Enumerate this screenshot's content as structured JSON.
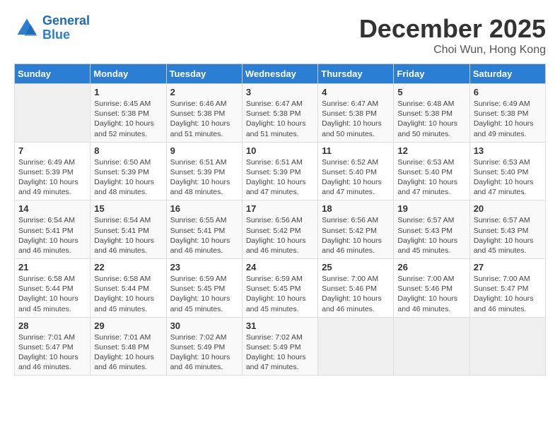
{
  "header": {
    "logo_line1": "General",
    "logo_line2": "Blue",
    "month": "December 2025",
    "location": "Choi Wun, Hong Kong"
  },
  "days_of_week": [
    "Sunday",
    "Monday",
    "Tuesday",
    "Wednesday",
    "Thursday",
    "Friday",
    "Saturday"
  ],
  "weeks": [
    [
      {
        "day": "",
        "empty": true
      },
      {
        "day": "1",
        "sunrise": "Sunrise: 6:45 AM",
        "sunset": "Sunset: 5:38 PM",
        "daylight": "Daylight: 10 hours and 52 minutes."
      },
      {
        "day": "2",
        "sunrise": "Sunrise: 6:46 AM",
        "sunset": "Sunset: 5:38 PM",
        "daylight": "Daylight: 10 hours and 51 minutes."
      },
      {
        "day": "3",
        "sunrise": "Sunrise: 6:47 AM",
        "sunset": "Sunset: 5:38 PM",
        "daylight": "Daylight: 10 hours and 51 minutes."
      },
      {
        "day": "4",
        "sunrise": "Sunrise: 6:47 AM",
        "sunset": "Sunset: 5:38 PM",
        "daylight": "Daylight: 10 hours and 50 minutes."
      },
      {
        "day": "5",
        "sunrise": "Sunrise: 6:48 AM",
        "sunset": "Sunset: 5:38 PM",
        "daylight": "Daylight: 10 hours and 50 minutes."
      },
      {
        "day": "6",
        "sunrise": "Sunrise: 6:49 AM",
        "sunset": "Sunset: 5:38 PM",
        "daylight": "Daylight: 10 hours and 49 minutes."
      }
    ],
    [
      {
        "day": "7",
        "sunrise": "Sunrise: 6:49 AM",
        "sunset": "Sunset: 5:39 PM",
        "daylight": "Daylight: 10 hours and 49 minutes."
      },
      {
        "day": "8",
        "sunrise": "Sunrise: 6:50 AM",
        "sunset": "Sunset: 5:39 PM",
        "daylight": "Daylight: 10 hours and 48 minutes."
      },
      {
        "day": "9",
        "sunrise": "Sunrise: 6:51 AM",
        "sunset": "Sunset: 5:39 PM",
        "daylight": "Daylight: 10 hours and 48 minutes."
      },
      {
        "day": "10",
        "sunrise": "Sunrise: 6:51 AM",
        "sunset": "Sunset: 5:39 PM",
        "daylight": "Daylight: 10 hours and 47 minutes."
      },
      {
        "day": "11",
        "sunrise": "Sunrise: 6:52 AM",
        "sunset": "Sunset: 5:40 PM",
        "daylight": "Daylight: 10 hours and 47 minutes."
      },
      {
        "day": "12",
        "sunrise": "Sunrise: 6:53 AM",
        "sunset": "Sunset: 5:40 PM",
        "daylight": "Daylight: 10 hours and 47 minutes."
      },
      {
        "day": "13",
        "sunrise": "Sunrise: 6:53 AM",
        "sunset": "Sunset: 5:40 PM",
        "daylight": "Daylight: 10 hours and 47 minutes."
      }
    ],
    [
      {
        "day": "14",
        "sunrise": "Sunrise: 6:54 AM",
        "sunset": "Sunset: 5:41 PM",
        "daylight": "Daylight: 10 hours and 46 minutes."
      },
      {
        "day": "15",
        "sunrise": "Sunrise: 6:54 AM",
        "sunset": "Sunset: 5:41 PM",
        "daylight": "Daylight: 10 hours and 46 minutes."
      },
      {
        "day": "16",
        "sunrise": "Sunrise: 6:55 AM",
        "sunset": "Sunset: 5:41 PM",
        "daylight": "Daylight: 10 hours and 46 minutes."
      },
      {
        "day": "17",
        "sunrise": "Sunrise: 6:56 AM",
        "sunset": "Sunset: 5:42 PM",
        "daylight": "Daylight: 10 hours and 46 minutes."
      },
      {
        "day": "18",
        "sunrise": "Sunrise: 6:56 AM",
        "sunset": "Sunset: 5:42 PM",
        "daylight": "Daylight: 10 hours and 46 minutes."
      },
      {
        "day": "19",
        "sunrise": "Sunrise: 6:57 AM",
        "sunset": "Sunset: 5:43 PM",
        "daylight": "Daylight: 10 hours and 45 minutes."
      },
      {
        "day": "20",
        "sunrise": "Sunrise: 6:57 AM",
        "sunset": "Sunset: 5:43 PM",
        "daylight": "Daylight: 10 hours and 45 minutes."
      }
    ],
    [
      {
        "day": "21",
        "sunrise": "Sunrise: 6:58 AM",
        "sunset": "Sunset: 5:44 PM",
        "daylight": "Daylight: 10 hours and 45 minutes."
      },
      {
        "day": "22",
        "sunrise": "Sunrise: 6:58 AM",
        "sunset": "Sunset: 5:44 PM",
        "daylight": "Daylight: 10 hours and 45 minutes."
      },
      {
        "day": "23",
        "sunrise": "Sunrise: 6:59 AM",
        "sunset": "Sunset: 5:45 PM",
        "daylight": "Daylight: 10 hours and 45 minutes."
      },
      {
        "day": "24",
        "sunrise": "Sunrise: 6:59 AM",
        "sunset": "Sunset: 5:45 PM",
        "daylight": "Daylight: 10 hours and 45 minutes."
      },
      {
        "day": "25",
        "sunrise": "Sunrise: 7:00 AM",
        "sunset": "Sunset: 5:46 PM",
        "daylight": "Daylight: 10 hours and 46 minutes."
      },
      {
        "day": "26",
        "sunrise": "Sunrise: 7:00 AM",
        "sunset": "Sunset: 5:46 PM",
        "daylight": "Daylight: 10 hours and 46 minutes."
      },
      {
        "day": "27",
        "sunrise": "Sunrise: 7:00 AM",
        "sunset": "Sunset: 5:47 PM",
        "daylight": "Daylight: 10 hours and 46 minutes."
      }
    ],
    [
      {
        "day": "28",
        "sunrise": "Sunrise: 7:01 AM",
        "sunset": "Sunset: 5:47 PM",
        "daylight": "Daylight: 10 hours and 46 minutes."
      },
      {
        "day": "29",
        "sunrise": "Sunrise: 7:01 AM",
        "sunset": "Sunset: 5:48 PM",
        "daylight": "Daylight: 10 hours and 46 minutes."
      },
      {
        "day": "30",
        "sunrise": "Sunrise: 7:02 AM",
        "sunset": "Sunset: 5:49 PM",
        "daylight": "Daylight: 10 hours and 46 minutes."
      },
      {
        "day": "31",
        "sunrise": "Sunrise: 7:02 AM",
        "sunset": "Sunset: 5:49 PM",
        "daylight": "Daylight: 10 hours and 47 minutes."
      },
      {
        "day": "",
        "empty": true
      },
      {
        "day": "",
        "empty": true
      },
      {
        "day": "",
        "empty": true
      }
    ]
  ]
}
